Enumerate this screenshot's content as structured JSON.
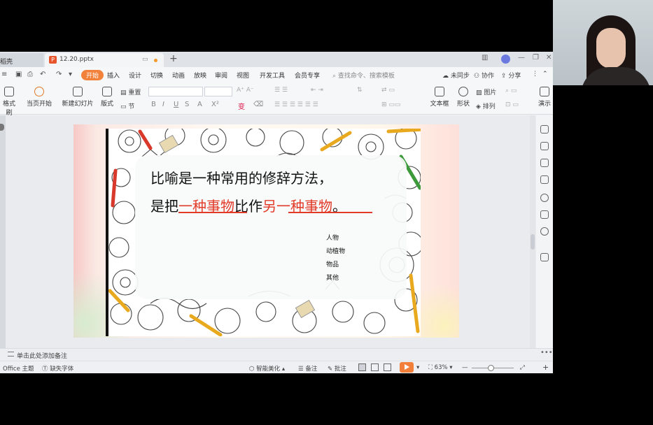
{
  "titlebar": {
    "home_tab": "稻壳",
    "file_name": "12.20.pptx",
    "new_tab": "+"
  },
  "menubar": {
    "tabs": [
      "开始",
      "插入",
      "设计",
      "切换",
      "动画",
      "放映",
      "审阅",
      "视图",
      "开发工具",
      "会员专享"
    ],
    "search_placeholder": "查找命令、搜索模板",
    "sync": "未同步",
    "collab": "协作",
    "share": "分享"
  },
  "toolbar": {
    "format_painter": "格式刷",
    "play_from_current": "当页开始",
    "new_slide": "新建幻灯片",
    "layout": "版式",
    "section": "节",
    "reset": "重置",
    "textbox": "文本框",
    "shape": "形状",
    "picture": "图片",
    "arrange": "排列",
    "presenter": "演示"
  },
  "slide": {
    "line1": "比喻是一种常用的修辞方法，",
    "line2_a": "是把",
    "line2_b": "一种事物",
    "line2_c": "比作",
    "line2_d": "另一种事物",
    "line2_e": "。",
    "categories": [
      "人物",
      "动植物",
      "物品",
      "其他"
    ],
    "accent_color": "#e23b2a"
  },
  "notes": {
    "placeholder": "单击此处添加备注"
  },
  "status": {
    "theme": "Office 主题",
    "missing_font": "缺失字体",
    "smart_beautify": "智能美化",
    "notes": "备注",
    "comments": "批注",
    "zoom": "63%"
  }
}
